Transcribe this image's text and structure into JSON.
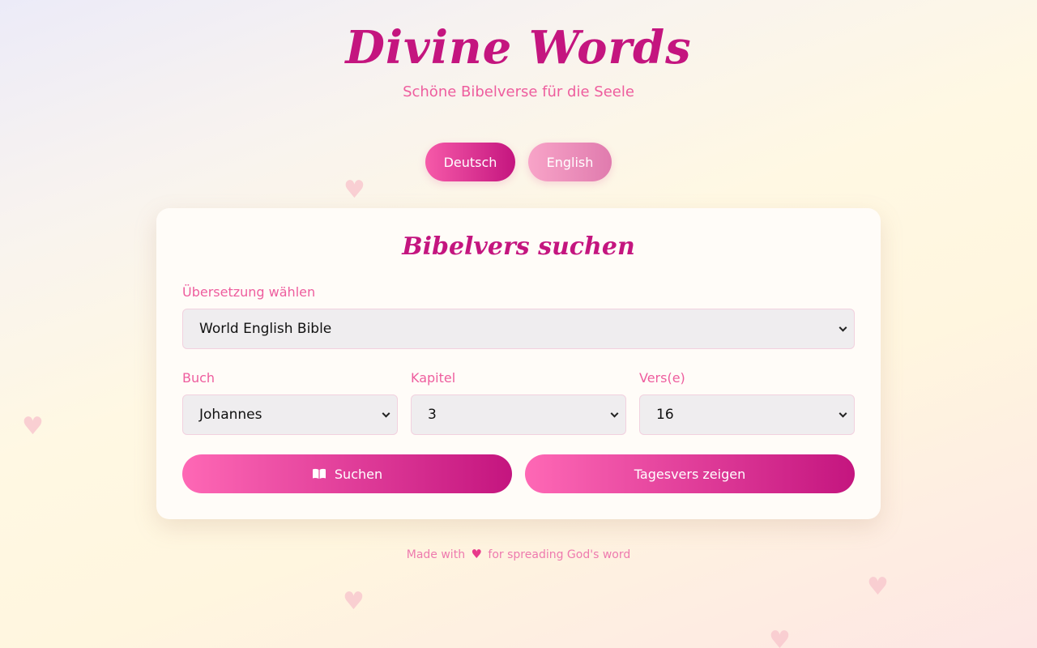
{
  "header": {
    "title": "Divine Words",
    "subtitle": "Schöne Bibelverse für die Seele"
  },
  "language": {
    "options": [
      "Deutsch",
      "English"
    ],
    "active": "Deutsch"
  },
  "search_card": {
    "title": "Bibelvers suchen",
    "translation_label": "Übersetzung wählen",
    "translation_value": "World English Bible",
    "book_label": "Buch",
    "book_value": "Johannes",
    "chapter_label": "Kapitel",
    "chapter_value": "3",
    "verse_label": "Vers(e)",
    "verse_value": "16",
    "search_button": "Suchen",
    "daily_button": "Tagesvers zeigen"
  },
  "footer": {
    "prefix": "Made with",
    "suffix": "for spreading God's word",
    "icon": "heart-icon"
  },
  "colors": {
    "accent": "#c4157f",
    "accent_light": "#fe68b5",
    "label": "#ee5d9e"
  }
}
